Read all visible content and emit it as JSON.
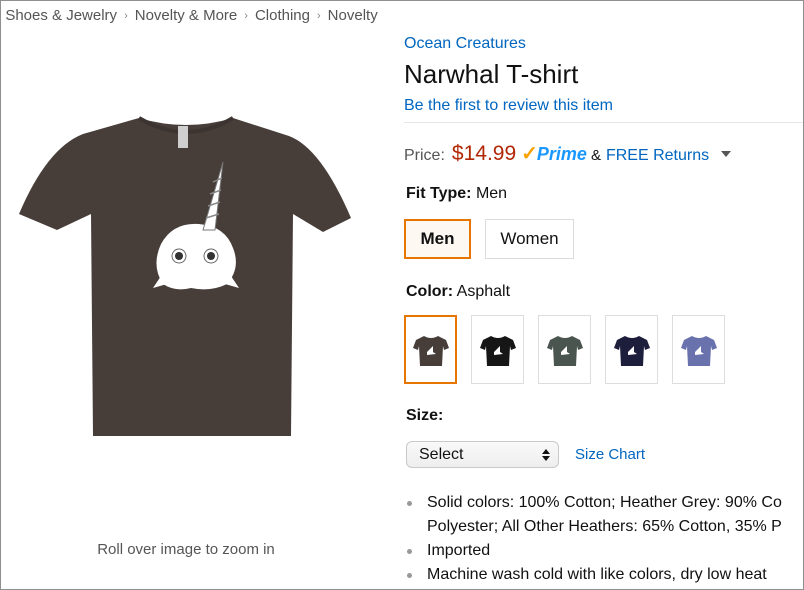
{
  "breadcrumb": {
    "items": [
      ", Shoes & Jewelry",
      "Novelty & More",
      "Clothing",
      "Novelty"
    ],
    "separator": "›"
  },
  "product": {
    "brand": "Ocean Creatures",
    "title": "Narwhal T-shirt",
    "review_link": "Be the first to review this item",
    "image_hint": "Roll over image to zoom in",
    "image_color": "#473e3a"
  },
  "price": {
    "label": "Price:",
    "value": "$14.99",
    "prime_check": "✓",
    "prime_label": "Prime",
    "ampersand": "&",
    "returns_label": "FREE Returns"
  },
  "fit_type": {
    "label": "Fit Type:",
    "selected": "Men",
    "options": [
      {
        "label": "Men",
        "selected": true
      },
      {
        "label": "Women",
        "selected": false
      }
    ]
  },
  "color": {
    "label": "Color:",
    "selected": "Asphalt",
    "swatches": [
      {
        "name": "Asphalt",
        "hex": "#473e3a",
        "selected": true
      },
      {
        "name": "Black",
        "hex": "#161616",
        "selected": false
      },
      {
        "name": "Slate",
        "hex": "#4b5550",
        "selected": false
      },
      {
        "name": "Navy",
        "hex": "#1d1d3c",
        "selected": false
      },
      {
        "name": "Heather Blue",
        "hex": "#6a72ae",
        "selected": false
      }
    ]
  },
  "size": {
    "label": "Size:",
    "select_value": "Select",
    "size_chart_link": "Size Chart"
  },
  "features": [
    {
      "lines": [
        "Solid colors: 100% Cotton; Heather Grey: 90% Co",
        "Polyester; All Other Heathers: 65% Cotton, 35% P"
      ]
    },
    {
      "lines": [
        "Imported"
      ]
    },
    {
      "lines": [
        "Machine wash cold with like colors, dry low heat"
      ]
    }
  ],
  "colors": {
    "link": "#0066c0",
    "price": "#b12704",
    "selected_border": "#e77600",
    "prime_check": "#f7a300",
    "prime_text": "#1a98ff"
  }
}
